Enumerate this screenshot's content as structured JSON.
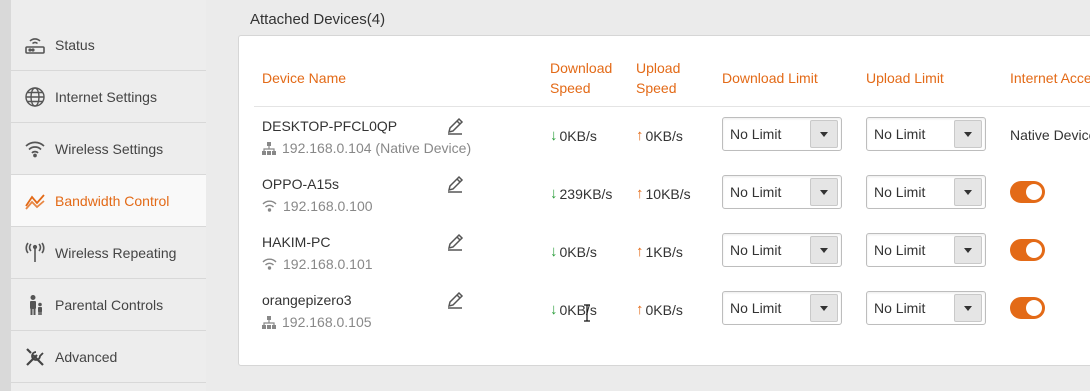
{
  "sidebar": {
    "items": [
      {
        "label": "Status",
        "icon": "router-icon",
        "active": false
      },
      {
        "label": "Internet Settings",
        "icon": "globe-icon",
        "active": false
      },
      {
        "label": "Wireless Settings",
        "icon": "wifi-icon",
        "active": false
      },
      {
        "label": "Bandwidth Control",
        "icon": "bandwidth-icon",
        "active": true
      },
      {
        "label": "Wireless Repeating",
        "icon": "repeater-icon",
        "active": false
      },
      {
        "label": "Parental Controls",
        "icon": "parental-icon",
        "active": false
      },
      {
        "label": "Advanced",
        "icon": "tools-icon",
        "active": false
      }
    ]
  },
  "section": {
    "title": "Attached Devices(4)"
  },
  "table": {
    "headers": {
      "device_name": "Device Name",
      "download_speed_1": "Download",
      "download_speed_2": "Speed",
      "upload_speed_1": "Upload",
      "upload_speed_2": "Speed",
      "download_limit": "Download Limit",
      "upload_limit": "Upload Limit",
      "internet_access": "Internet Access"
    },
    "rows": [
      {
        "name": "DESKTOP-PFCL0QP",
        "ip": "192.168.0.104 (Native Device)",
        "conn": "wired",
        "down": "0KB/s",
        "up": "0KB/s",
        "down_limit": "No Limit",
        "up_limit": "No Limit",
        "access": "Native Device"
      },
      {
        "name": "OPPO-A15s",
        "ip": "192.168.0.100",
        "conn": "wireless",
        "down": "239KB/s",
        "up": "10KB/s",
        "down_limit": "No Limit",
        "up_limit": "No Limit",
        "access": "on"
      },
      {
        "name": "HAKIM-PC",
        "ip": "192.168.0.101",
        "conn": "wireless",
        "down": "0KB/s",
        "up": "1KB/s",
        "down_limit": "No Limit",
        "up_limit": "No Limit",
        "access": "on"
      },
      {
        "name": "orangepizero3",
        "ip": "192.168.0.105",
        "conn": "wired",
        "down": "0KB/s",
        "up": "0KB/s",
        "down_limit": "No Limit",
        "up_limit": "No Limit",
        "access": "on"
      }
    ]
  },
  "colors": {
    "accent": "#e36a17",
    "download_arrow": "#2a9d3a"
  }
}
